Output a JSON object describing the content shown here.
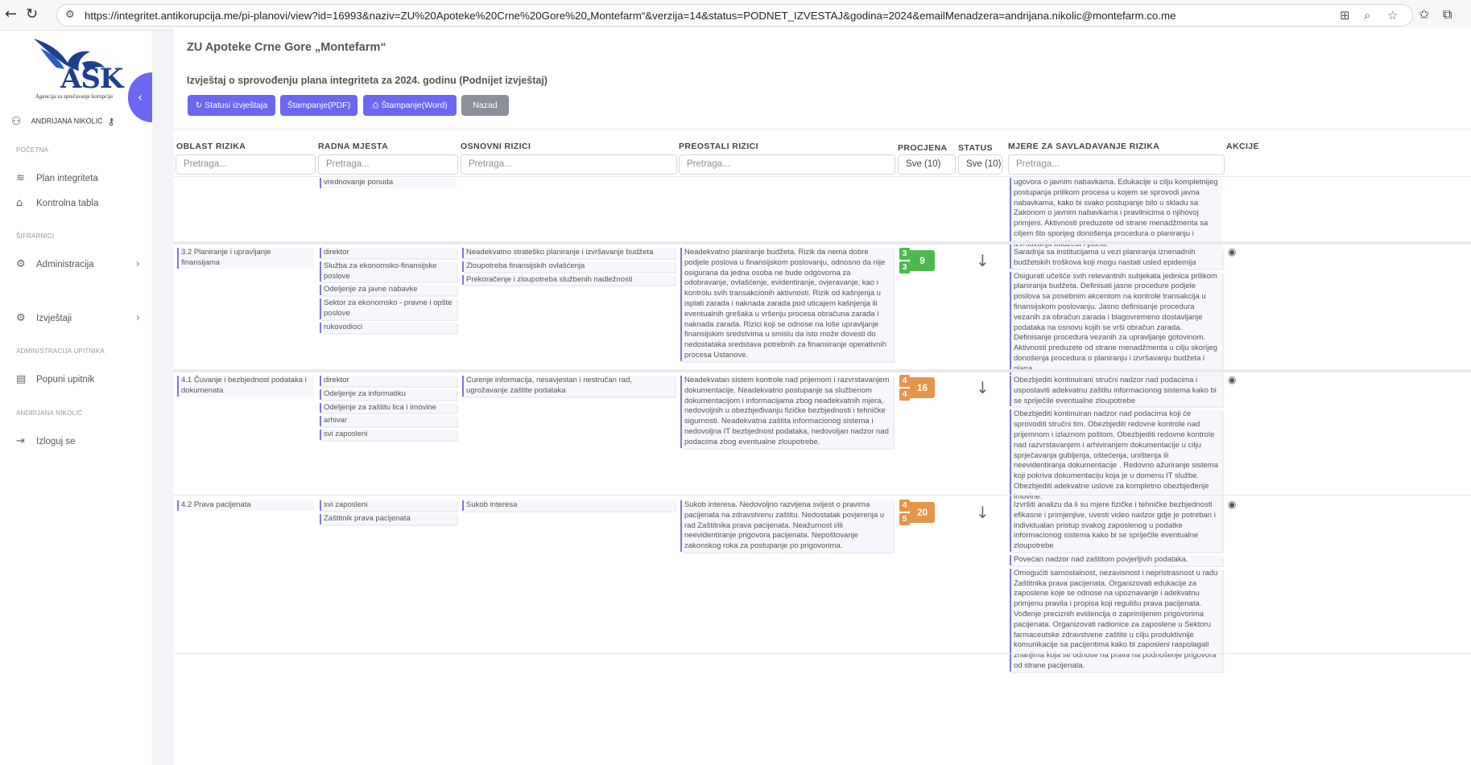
{
  "browser": {
    "url": "https://integritet.antikorupcija.me/pi-planovi/view?id=16993&naziv=ZU%20Apoteke%20Crne%20Gore%20„Montefarm“&verzija=14&status=PODNET_IZVESTAJ&godina=2024&emailMenadzera=andrijana.nikolic@montefarm.co.me"
  },
  "sidebar": {
    "logo_text": "ASK",
    "logo_subtitle": "Agencija za sprečavanje korupcije",
    "user_name": "ANDRIJANA NIKOLIĆ",
    "sections": [
      "POČETNA",
      "ŠIFRARNICI",
      "ADMINISTRACIJA UPITNIKA",
      "ANDRIJANA NIKOLIĆ"
    ],
    "items": [
      {
        "label": "Plan integriteta",
        "icon": "layers-icon"
      },
      {
        "label": "Kontrolna tabla",
        "icon": "home-icon"
      },
      {
        "label": "Administracija",
        "icon": "gear-icon"
      },
      {
        "label": "Izvještaji",
        "icon": "gear-icon"
      },
      {
        "label": "Popuni upitnik",
        "icon": "document-icon"
      },
      {
        "label": "Izloguj se",
        "icon": "logout-icon"
      }
    ]
  },
  "header": {
    "org_title": "ZU Apoteke Crne Gore „Montefarm“",
    "report_title": "Izvještaj o sprovođenju plana integriteta za 2024. godinu (Podnijet izvještaj)",
    "buttons": {
      "status": "Statusi izvještaja",
      "print_pdf": "Štampanje(PDF)",
      "print_word": "Štampanje(Word)",
      "back": "Nazad"
    }
  },
  "table": {
    "columns": [
      "OBLAST RIZIKA",
      "RADNA MJESTA",
      "OSNOVNI RIZICI",
      "PREOSTALI RIZICI",
      "PROCJENA",
      "STATUS",
      "MJERE ZA SAVLADAVANJE RIZIKA",
      "AKCIJE"
    ],
    "filter_placeholder": "Pretraga...",
    "select_value": "Sve (10)",
    "partial_row": {
      "jobs_tail": "vrednovanje ponuda",
      "measure_tail": "ugovora o javnim nabavkama. Edukacije u cilju kompletnijeg postupanja prilikom procesa u kojem se sprovodi javna nabavkama, kako bi svako postupanje bilo u skladu sa Zakonom o javnim nabavkama i pravilnicima o njihovoj primjeni. Aktivnosti preduzete od strane menadžmenta sa ciljem što sporijeg donošenja procedura o planiranju i izvršavanju budžeta i plana."
    },
    "rows": [
      {
        "area": "3.2 Planiranje i upravljanje finansijama",
        "jobs": [
          "direktor",
          "Služba za ekonomsko-finansijske poslove",
          "Odeljenje za javne nabavke",
          "Sektor za ekonomsko - pravne i opšte poslove",
          "rukovodioci"
        ],
        "basic_risks": [
          "Neadekvatno strateško planiranje i izvršavanje budžeta",
          "Zloupotreba finansijskih ovlašćenja",
          "Prekoračenje i zloupotreba službenih nadležnosti"
        ],
        "remaining_risk": "Neadekvatno planiranje budžeta. Rizik da nema dobre podjele poslova u finansijskom poslovanju, odnosno da nije osigurana da jedna osoba ne bude odgovorna za odobravanje, ovlašćenje, evidentiranje, ovjeravanje, kao i kontrolu svih transakcionih aktivnosti. Rizik od kašnjenja u isplati zarada i naknada zarada pod uticajem kašnjenja ili eventualnih grešaka u vršenju procesa obračuna zarada i naknada zarada. Rizici koji se odnose na loše upravljanje finansijskim sredstvima u smislu da isto može dovesti do nedostataka sredstava potrebnih za finansiranje operativnih procesa Ustanove.",
        "score": {
          "a": "3",
          "b": "3",
          "total": "9",
          "color": "green"
        },
        "measures": [
          "Saradnja sa institucijama u vezi planiranja iznenadnih budžetskih troškova koji mogu nastati usled epidemija",
          "Osigurati učešće svih relevantnih subjekata jedinica prilikom planiranja budžeta. Definisati jasne procedure podjele poslova sa posebnim akcentom na kontrole transakcija u finansijskom poslovanju. Jasno definisanje procedura vezanih za obračun zarada i blagovremeno dostavljanje podataka na osnovu kojih se vrši obračun zarada. Definisanje procedura vezanih za upravljanje gotovinom. Aktivnosti preduzete od strane menadžmenta u cilju skorijeg donošenja procedura o planiranju i izvršavanju budžeta i plana."
        ]
      },
      {
        "area": "4.1 Čuvanje i bezbjednost podataka i dokumenata",
        "jobs": [
          "direktor",
          "Odeljenje za informatiku",
          "Odeljenje za zaštitu lica i imovine",
          "arhivar",
          "svi zaposleni"
        ],
        "basic_risks": [
          "Curenje informacija, nesavjestan i nestručan rad, ugrožavanje zaštite podataka"
        ],
        "remaining_risk": "Neadekvatan sistem kontrole nad prijemom i razvrstavanjem dokumentacije. Neadekvatno postupanje sa službenom dokumentacijom i informacijama zbog neadekvatnih mjera, nedovoljnih u obezbjeđivanju fizičke bezbjednosti i tehničke sigurnosti. Neadekvatna zaštita informacionog sistema i nedovoljna IT bezbjednost podataka, nedovoljan nadzor nad podacima zbog eventualne zloupotrebe.",
        "score": {
          "a": "4",
          "b": "4",
          "total": "16",
          "color": "orange"
        },
        "measures": [
          "Obezbjediti kontinuirani stručni nadzor nad podacima i uspostaviti adekvatnu zaštitu informacionog sistema kako bi se spriječile eventualne zloupotrebe",
          "Obezbjediti kontinuiran nadzor nad podacima koji će sprovoditi stručni tim. Obezbjediti redovne kontrole nad prijemnom i izlaznom poštom. Obezbjediti redovne kontrole nad razvrstavanjem i arhiviranjem dokumentacije u cilju sprječavanja gubljenja, oštećenja, uništenja ili neevidentiranja dokumentacije . Redovno ažuriranje sistema koji pokriva dokumentaciju koja je u domenu IT službe. Obezbjediti adekvatne uslove za kompletno obezbjeđenje imovine."
        ]
      },
      {
        "area": "4.2 Prava pacijenata",
        "jobs": [
          "svi zaposleni",
          "Zaštitnik prava pacijenata"
        ],
        "basic_risks": [
          "Sukob interesa"
        ],
        "remaining_risk": "Sukob interesa. Nedovoljno razvijena svijest o pravima pacijenata na zdravstvenu zaštitu. Nedostatak povjerenja u rad Zaštitnika prava pacijenata. Neažurnost i/ili neevidentiranje prigovora pacijenata. Nepoštovanje zakonskog roka za postupanje po prigovorima.",
        "score": {
          "a": "4",
          "b": "5",
          "total": "20",
          "color": "orange"
        },
        "measures": [
          "Izvršiti analizu da li su mjere fizičke i tehničke bezbjednosti efikasne i primjenjive, uvesti video nadzor gdje je potreban i individualan pristup svakog zaposlenog u podatke informacionog sistema kako bi se spriječile eventualne zloupotrebe",
          "Povećan nadzor nad zaštitom povjerljivih podataka.",
          "Omogućiti samostalnost, nezavisnost i nepristrasnost u radu Zaštitnika prava pacijenata. Organizovati edukacije za zaposlene koje se odnose na upoznavanje i adekvatnu primjenu pravila i propisa koji regulišu prava pacijenata. Vođenje preciznih evidencija o zaprimljenim prigovorima pacijenata. Organizovati radionice za zaposlene u Sektoru farmaceutske zdravstvene zaštite u cilju produktivnije komunikacije sa pacijentima kako bi zaposleni raspolagali znanjima koja se odnose na prava na podnošenje prigovora od strane pacijenata."
        ]
      }
    ]
  }
}
